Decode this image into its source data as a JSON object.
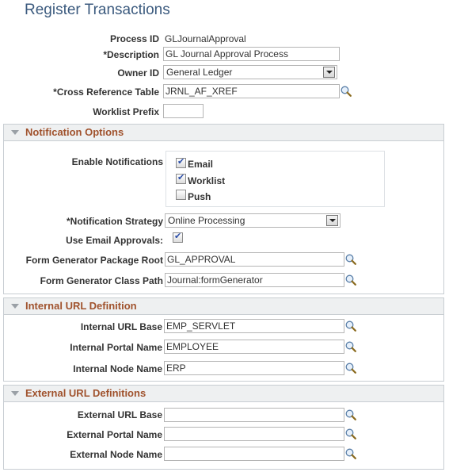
{
  "page": {
    "title": "Register Transactions"
  },
  "header_fields": {
    "process_id": {
      "label": "Process ID",
      "value": "GLJournalApproval"
    },
    "description": {
      "label": "*Description",
      "value": "GL Journal Approval Process"
    },
    "owner_id": {
      "label": "Owner ID",
      "value": "General Ledger"
    },
    "xref_table": {
      "label": "*Cross Reference Table",
      "value": "JRNL_AF_XREF"
    },
    "worklist_prefix": {
      "label": "Worklist Prefix",
      "value": ""
    }
  },
  "notification": {
    "title": "Notification Options",
    "enable_label": "Enable Notifications",
    "options": [
      {
        "label": "Email",
        "checked": true
      },
      {
        "label": "Worklist",
        "checked": true
      },
      {
        "label": "Push",
        "checked": false
      }
    ],
    "strategy": {
      "label": "*Notification Strategy",
      "value": "Online Processing"
    },
    "use_email": {
      "label": "Use Email Approvals:",
      "checked": true
    },
    "pkg_root": {
      "label": "Form Generator Package Root",
      "value": "GL_APPROVAL"
    },
    "class_path": {
      "label": "Form Generator Class Path",
      "value": "Journal:formGenerator"
    }
  },
  "internal": {
    "title": "Internal URL Definition",
    "url_base": {
      "label": "Internal URL Base",
      "value": "EMP_SERVLET"
    },
    "portal": {
      "label": "Internal Portal Name",
      "value": "EMPLOYEE"
    },
    "node": {
      "label": "Internal Node Name",
      "value": "ERP"
    }
  },
  "external": {
    "title": "External URL Definitions",
    "url_base": {
      "label": "External URL Base",
      "value": ""
    },
    "portal": {
      "label": "External Portal Name",
      "value": ""
    },
    "node": {
      "label": "External Node Name",
      "value": ""
    }
  }
}
